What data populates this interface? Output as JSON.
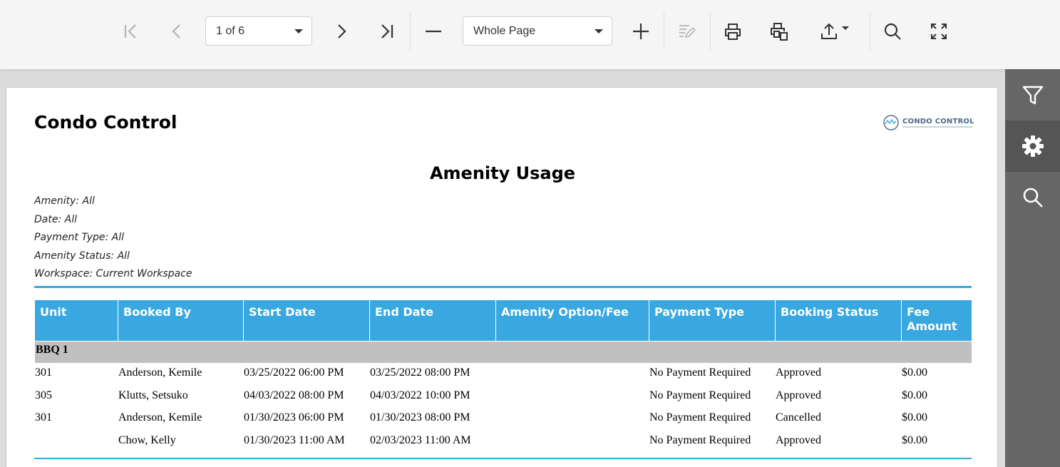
{
  "toolbar": {
    "page_selector": "1 of 6",
    "zoom_selector": "Whole Page",
    "icons": {
      "first": "first-page-icon",
      "prev": "previous-page-icon",
      "next": "next-page-icon",
      "last": "last-page-icon",
      "zoom_out": "minus-icon",
      "zoom_in": "plus-icon",
      "edit": "edit-icon",
      "print": "print-icon",
      "print_page": "print-page-icon",
      "export": "export-icon",
      "search": "search-icon",
      "fullscreen": "fullscreen-icon"
    }
  },
  "sidepanel": {
    "icons": [
      "filter-icon",
      "gear-icon",
      "search-icon"
    ],
    "colors": {
      "background": "#666666",
      "active": "#555555"
    }
  },
  "report": {
    "company": "Condo Control",
    "logo_text": "CONDO CONTROL",
    "title": "Amenity Usage",
    "filters": [
      "Amenity: All",
      "Date: All",
      "Payment Type: All",
      "Amenity Status: All",
      "Workspace: Current Workspace"
    ],
    "columns": [
      "Unit",
      "Booked By",
      "Start Date",
      "End Date",
      "Amenity Option/Fee",
      "Payment Type",
      "Booking Status",
      "Fee Amount"
    ],
    "group": "BBQ 1",
    "rows": [
      [
        "301",
        "Anderson, Kemile",
        "03/25/2022 06:00 PM",
        "03/25/2022 08:00 PM",
        "",
        "No Payment Required",
        "Approved",
        "$0.00"
      ],
      [
        "305",
        "Klutts, Setsuko",
        "04/03/2022 08:00 PM",
        "04/03/2022 10:00 PM",
        "",
        "No Payment Required",
        "Approved",
        "$0.00"
      ],
      [
        "301",
        "Anderson, Kemile",
        "01/30/2023 06:00 PM",
        "01/30/2023 08:00 PM",
        "",
        "No Payment Required",
        "Cancelled",
        "$0.00"
      ],
      [
        "",
        "Chow, Kelly",
        "01/30/2023 11:00 AM",
        "02/03/2023 11:00 AM",
        "",
        "No Payment Required",
        "Approved",
        "$0.00"
      ]
    ],
    "colors": {
      "header": "#3aa8e0",
      "group": "#c0c0c0",
      "rule": "#3aa8dd"
    }
  }
}
